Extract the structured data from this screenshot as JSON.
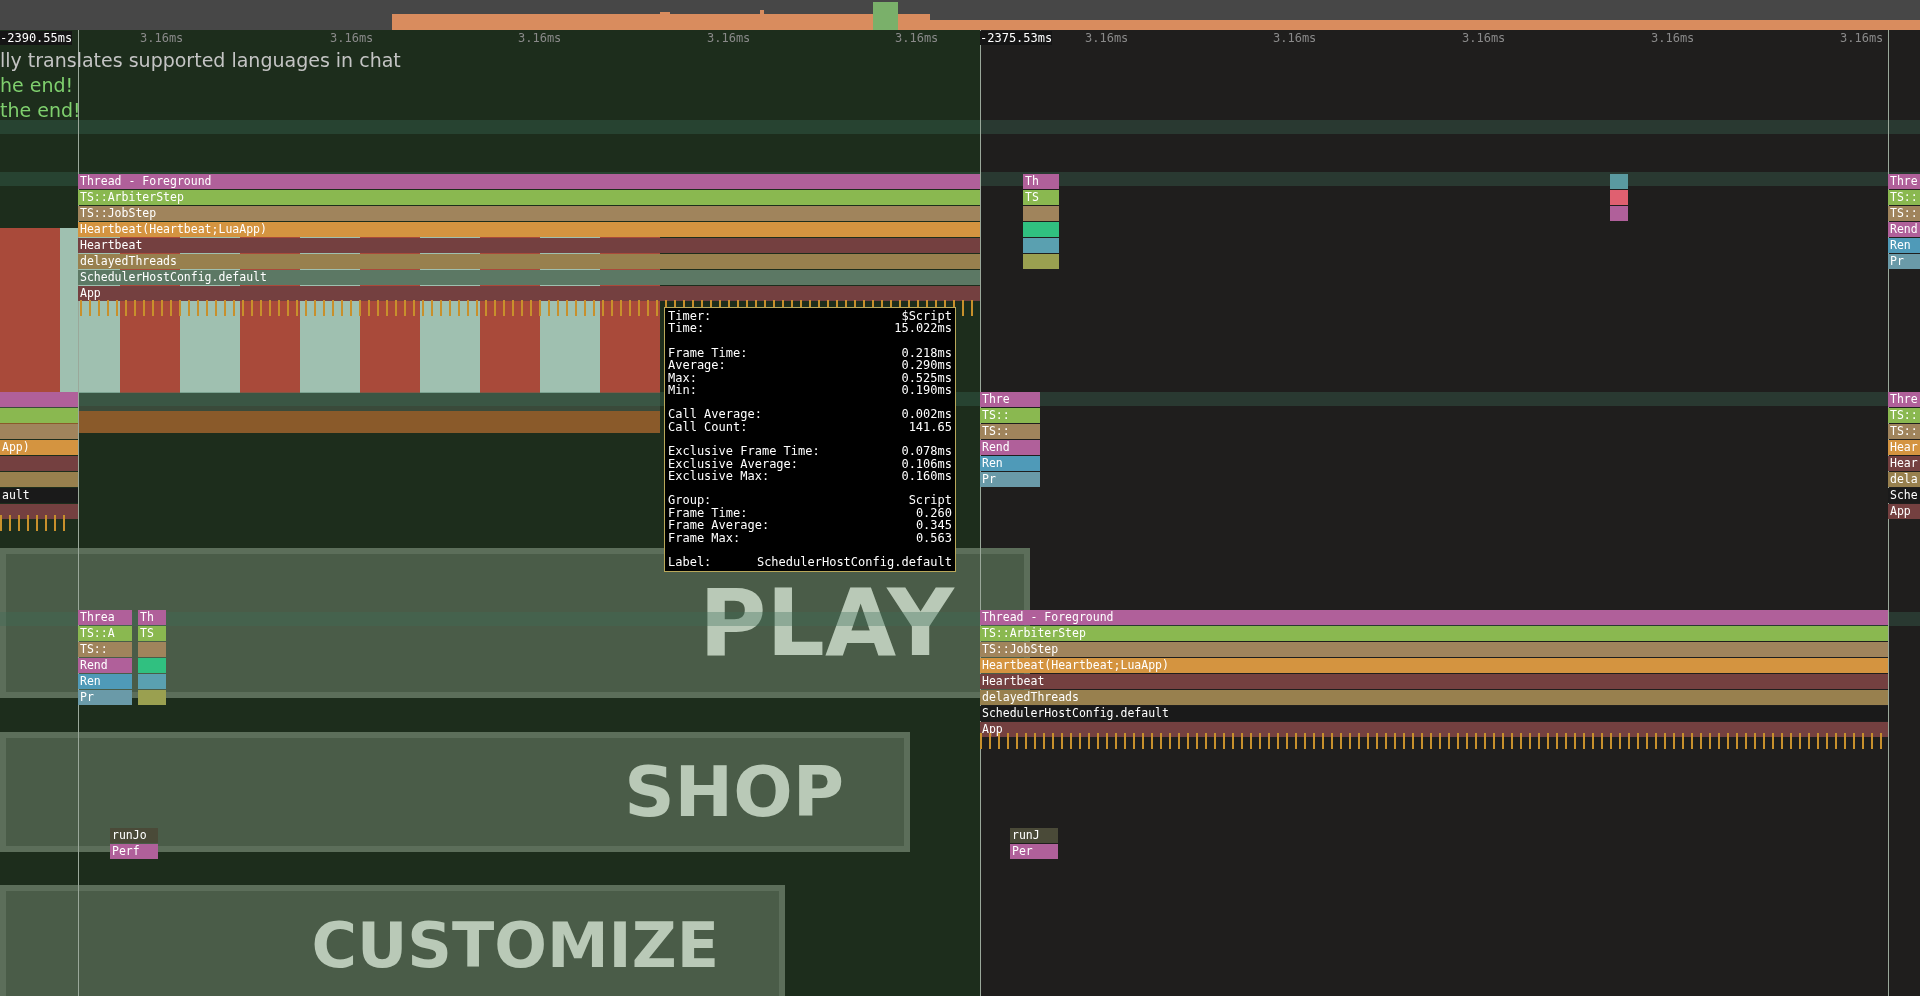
{
  "ruler": {
    "frames": [
      {
        "start": "-2390.55ms",
        "ticks": [
          "3.16ms",
          "3.16ms",
          "3.16ms",
          "3.16ms",
          "3.16ms"
        ]
      },
      {
        "start": "-2375.53ms",
        "ticks": [
          "3.16ms",
          "3.16ms",
          "3.16ms",
          "3.16ms",
          "3.16ms"
        ]
      }
    ]
  },
  "chat": [
    {
      "text": "lly translates supported languages in chat",
      "color": "#c4c4c4"
    },
    {
      "text": "he end!",
      "color": "#7fd06e"
    },
    {
      "text": "the end!",
      "color": "#7fd06e"
    }
  ],
  "game_buttons": [
    "PLAY",
    "SHOP",
    "CUSTOMIZE"
  ],
  "stacks": [
    {
      "bars": [
        {
          "label": "Thread - Foreground",
          "color": "#b0609a"
        },
        {
          "label": "TS::ArbiterStep",
          "color": "#8ab850"
        },
        {
          "label": "TS::JobStep",
          "color": "#a0845c"
        },
        {
          "label": "Heartbeat(Heartbeat;LuaApp)",
          "color": "#d49440"
        },
        {
          "label": "Heartbeat",
          "color": "#744040"
        },
        {
          "label": "delayedThreads",
          "color": "#98804e"
        },
        {
          "label": "SchedulerHostConfig.default",
          "color": "#5c7864"
        },
        {
          "label": "App",
          "color": "#744040"
        }
      ]
    },
    {
      "bars": [
        {
          "color": "#b0609a"
        },
        {
          "color": "#8ab850"
        },
        {
          "color": "#a0845c"
        },
        {
          "label": "App)",
          "color": "#d49440"
        },
        {
          "color": "#744040"
        },
        {
          "color": "#98804e"
        },
        {
          "label": "ault",
          "color": "#1a1a1a"
        },
        {
          "color": "#744040"
        }
      ]
    },
    {
      "bars": [
        {
          "label": "Th",
          "color": "#b0609a"
        },
        {
          "label": "TS",
          "color": "#8ab850"
        },
        {
          "color": "#a0845c"
        },
        {
          "color": "#30c080"
        },
        {
          "color": "#5aa0b0"
        },
        {
          "color": "#9aa050"
        }
      ]
    },
    {
      "bars": [
        {
          "label": "Thre",
          "color": "#b0609a"
        },
        {
          "label": "TS::",
          "color": "#8ab850"
        },
        {
          "label": "TS::",
          "color": "#a0845c"
        },
        {
          "label": "Rend",
          "color": "#b0609a"
        },
        {
          "label": "Ren",
          "color": "#4f9ab8"
        },
        {
          "label": "Pr",
          "color": "#6a9aa8"
        }
      ]
    },
    {
      "bars": [
        {
          "label": "Thre",
          "color": "#b0609a"
        },
        {
          "label": "TS::",
          "color": "#8ab850"
        },
        {
          "label": "TS::",
          "color": "#a0845c"
        },
        {
          "label": "Rend",
          "color": "#b0609a"
        },
        {
          "label": "Ren",
          "color": "#4f9ab8"
        },
        {
          "label": "Pr",
          "color": "#6a9aa8"
        }
      ]
    },
    {
      "bars": [
        {
          "label": "Thre",
          "color": "#b0609a"
        },
        {
          "label": "TS::",
          "color": "#8ab850"
        },
        {
          "label": "TS::",
          "color": "#a0845c"
        },
        {
          "label": "Hear",
          "color": "#d49440"
        },
        {
          "label": "Hear",
          "color": "#744040"
        },
        {
          "label": "dela",
          "color": "#98804e"
        },
        {
          "label": "Sche",
          "color": "#1a1a1a"
        },
        {
          "label": "App",
          "color": "#744040"
        }
      ]
    },
    {
      "bars": [
        {
          "label": "Threa",
          "color": "#b0609a"
        },
        {
          "label": "TS::A",
          "color": "#8ab850"
        },
        {
          "label": "TS::",
          "color": "#a0845c"
        },
        {
          "label": "Rend",
          "color": "#b0609a"
        },
        {
          "label": "Ren",
          "color": "#4f9ab8"
        },
        {
          "label": "Pr",
          "color": "#6a9aa8"
        }
      ]
    },
    {
      "bars": [
        {
          "label": "Th",
          "color": "#b0609a"
        },
        {
          "label": "TS",
          "color": "#8ab850"
        },
        {
          "color": "#a0845c"
        },
        {
          "color": "#30c080"
        },
        {
          "color": "#5aa0b0"
        },
        {
          "color": "#9aa050"
        }
      ]
    },
    {
      "bars": [
        {
          "label": "runJo",
          "color": "#4a4a38"
        },
        {
          "label": "Perf",
          "color": "#b0609a"
        }
      ]
    },
    {
      "bars": [
        {
          "label": "runJ",
          "color": "#4a4a38"
        },
        {
          "label": "Per",
          "color": "#b0609a"
        }
      ]
    },
    {
      "bars": [
        {
          "label": "Thread - Foreground",
          "color": "#b0609a"
        },
        {
          "label": "TS::ArbiterStep",
          "color": "#8ab850"
        },
        {
          "label": "TS::JobStep",
          "color": "#a0845c"
        },
        {
          "label": "Heartbeat(Heartbeat;LuaApp)",
          "color": "#d49440"
        },
        {
          "label": "Heartbeat",
          "color": "#744040"
        },
        {
          "label": "delayedThreads",
          "color": "#98804e"
        },
        {
          "label": "SchedulerHostConfig.default",
          "color": "#1a1a1a"
        },
        {
          "label": "App",
          "color": "#744040"
        }
      ]
    },
    {
      "bars": [
        {
          "color": "#5a9aa0"
        },
        {
          "color": "#e06070"
        },
        {
          "color": "#b0609a"
        }
      ]
    }
  ],
  "tooltip": {
    "sections": [
      [
        {
          "key": "Timer:",
          "value": "$Script"
        },
        {
          "key": "Time:",
          "value": "15.022ms"
        }
      ],
      [
        {
          "key": "Frame Time:",
          "value": "0.218ms"
        },
        {
          "key": "Average:",
          "value": "0.290ms"
        },
        {
          "key": "Max:",
          "value": "0.525ms"
        },
        {
          "key": "Min:",
          "value": "0.190ms"
        }
      ],
      [
        {
          "key": "Call Average:",
          "value": "0.002ms"
        },
        {
          "key": "Call Count:",
          "value": "141.65"
        }
      ],
      [
        {
          "key": "Exclusive Frame Time:",
          "value": "0.078ms"
        },
        {
          "key": "Exclusive Average:",
          "value": "0.106ms"
        },
        {
          "key": "Exclusive Max:",
          "value": "0.160ms"
        }
      ],
      [
        {
          "key": "Group:",
          "value": "Script"
        },
        {
          "key": "Frame Time:",
          "value": "0.260"
        },
        {
          "key": "Frame Average:",
          "value": "0.345"
        },
        {
          "key": "Frame Max:",
          "value": "0.563"
        }
      ],
      [
        {
          "key": "Label:",
          "value": "SchedulerHostConfig.default"
        }
      ]
    ]
  }
}
